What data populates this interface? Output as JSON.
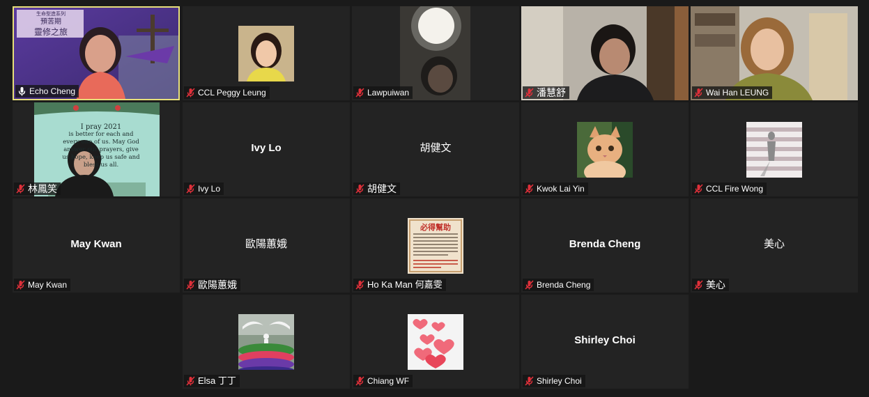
{
  "meeting": {
    "participants": [
      {
        "name": "Echo Cheng",
        "muted": false,
        "active_speaker": true,
        "thumb_text": [
          "生命型造系列",
          "預苦期",
          "靈修之旅"
        ]
      },
      {
        "name": "CCL Peggy Leung",
        "muted": true
      },
      {
        "name": "Lawpuiwan",
        "muted": true
      },
      {
        "name": "潘慧舒",
        "muted": true
      },
      {
        "name": "Wai Han LEUNG",
        "muted": true
      },
      {
        "name": "林鳳笑",
        "muted": true,
        "thumb_text": [
          "I pray 2021",
          "is better for each and",
          "every one of us. May God",
          "answer our prayers, give",
          "us hope, keep us safe and",
          "bless us all."
        ]
      },
      {
        "name": "Ivy Lo",
        "display": "Ivy Lo",
        "muted": true
      },
      {
        "name": "胡健文",
        "display": "胡健文",
        "muted": true
      },
      {
        "name": "Kwok Lai Yin",
        "muted": true
      },
      {
        "name": "CCL Fire Wong",
        "muted": true
      },
      {
        "name": "May Kwan",
        "display": "May Kwan",
        "muted": true
      },
      {
        "name": "歐陽蕙娥",
        "display": "歐陽蕙娥",
        "muted": true
      },
      {
        "name": "Ho Ka Man 何嘉雯",
        "muted": true,
        "thumb_text": [
          "必得幫助"
        ]
      },
      {
        "name": "Brenda Cheng",
        "display": "Brenda Cheng",
        "muted": true
      },
      {
        "name": "美心",
        "display": "美心",
        "muted": true
      },
      {
        "name": "Elsa 丁丁",
        "muted": true
      },
      {
        "name": "Chiang WF",
        "muted": true
      },
      {
        "name": "Shirley Choi",
        "display": "Shirley Choi",
        "muted": true
      }
    ]
  },
  "colors": {
    "active_border": "#e8e07a",
    "muted_icon": "#e0303a",
    "tile_bg": "#232323",
    "page_bg": "#1a1a1a"
  }
}
